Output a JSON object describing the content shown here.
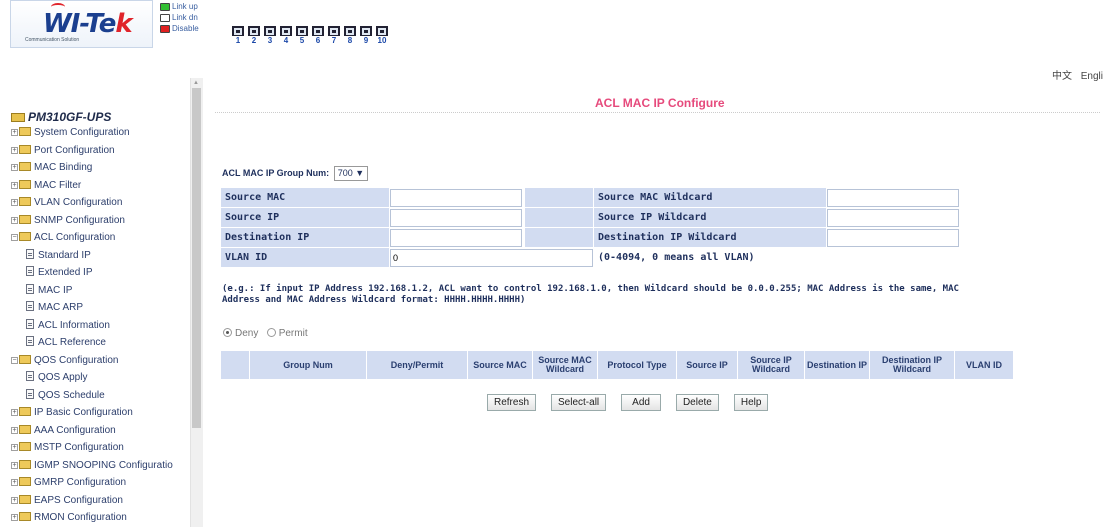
{
  "header": {
    "logo_text_main": "WI-Te",
    "logo_text_accent": "k",
    "logo_subtitle": "Communication Solution",
    "legend": [
      {
        "label": "Link up",
        "color": "#34c034"
      },
      {
        "label": "Link dn",
        "color": "#ffffff"
      },
      {
        "label": "Disable",
        "color": "#e02020"
      }
    ],
    "ports": [
      "1",
      "2",
      "3",
      "4",
      "5",
      "6",
      "7",
      "8",
      "9",
      "10"
    ],
    "language": [
      "中文",
      "Engli"
    ]
  },
  "sidebar": {
    "device": "PM310GF-UPS",
    "items": [
      {
        "label": "System Configuration",
        "type": "folder",
        "expanded": false
      },
      {
        "label": "Port Configuration",
        "type": "folder",
        "expanded": false
      },
      {
        "label": "MAC Binding",
        "type": "folder",
        "expanded": false
      },
      {
        "label": "MAC Filter",
        "type": "folder",
        "expanded": false
      },
      {
        "label": "VLAN Configuration",
        "type": "folder",
        "expanded": false
      },
      {
        "label": "SNMP Configuration",
        "type": "folder",
        "expanded": false
      },
      {
        "label": "ACL Configuration",
        "type": "folder",
        "expanded": true
      },
      {
        "label": "Standard IP",
        "type": "doc"
      },
      {
        "label": "Extended IP",
        "type": "doc"
      },
      {
        "label": "MAC IP",
        "type": "doc"
      },
      {
        "label": "MAC ARP",
        "type": "doc"
      },
      {
        "label": "ACL Information",
        "type": "doc"
      },
      {
        "label": "ACL Reference",
        "type": "doc"
      },
      {
        "label": "QOS Configuration",
        "type": "folder",
        "expanded": true
      },
      {
        "label": "QOS Apply",
        "type": "doc"
      },
      {
        "label": "QOS Schedule",
        "type": "doc"
      },
      {
        "label": "IP Basic Configuration",
        "type": "folder",
        "expanded": false
      },
      {
        "label": "AAA Configuration",
        "type": "folder",
        "expanded": false
      },
      {
        "label": "MSTP Configuration",
        "type": "folder",
        "expanded": false
      },
      {
        "label": "IGMP SNOOPING Configuratio",
        "type": "folder",
        "expanded": false
      },
      {
        "label": "GMRP Configuration",
        "type": "folder",
        "expanded": false
      },
      {
        "label": "EAPS Configuration",
        "type": "folder",
        "expanded": false
      },
      {
        "label": "RMON Configuration",
        "type": "folder",
        "expanded": false
      }
    ]
  },
  "main": {
    "title": "ACL MAC IP Configure",
    "group_num_label": "ACL MAC IP Group Num:",
    "group_num_value": "700",
    "form": {
      "source_mac_label": "Source MAC",
      "source_mac_value": "",
      "source_mac_wildcard_label": "Source MAC Wildcard",
      "source_mac_wildcard_value": "",
      "source_ip_label": "Source IP",
      "source_ip_value": "",
      "source_ip_wildcard_label": "Source IP Wildcard",
      "source_ip_wildcard_value": "",
      "destination_ip_label": "Destination IP",
      "destination_ip_value": "",
      "destination_ip_wildcard_label": "Destination IP Wildcard",
      "destination_ip_wildcard_value": "",
      "vlan_id_label": "VLAN ID",
      "vlan_id_value": "0",
      "vlan_note": "(0-4094, 0 means all VLAN)"
    },
    "hint": "(e.g.: If input IP Address 192.168.1.2, ACL want to control 192.168.1.0, then Wildcard should be 0.0.0.255; MAC Address is the same, MAC Address and MAC Address Wildcard format: HHHH.HHHH.HHHH)",
    "radio": {
      "deny": "Deny",
      "permit": "Permit",
      "selected": "Deny"
    },
    "table_headers": [
      "",
      "Group Num",
      "Deny/Permit",
      "Source MAC",
      "Source MAC Wildcard",
      "Protocol Type",
      "Source IP",
      "Source IP Wildcard",
      "Destination IP",
      "Destination IP Wildcard",
      "VLAN ID"
    ],
    "buttons": {
      "refresh": "Refresh",
      "select_all": "Select-all",
      "add": "Add",
      "delete": "Delete",
      "help": "Help"
    }
  }
}
